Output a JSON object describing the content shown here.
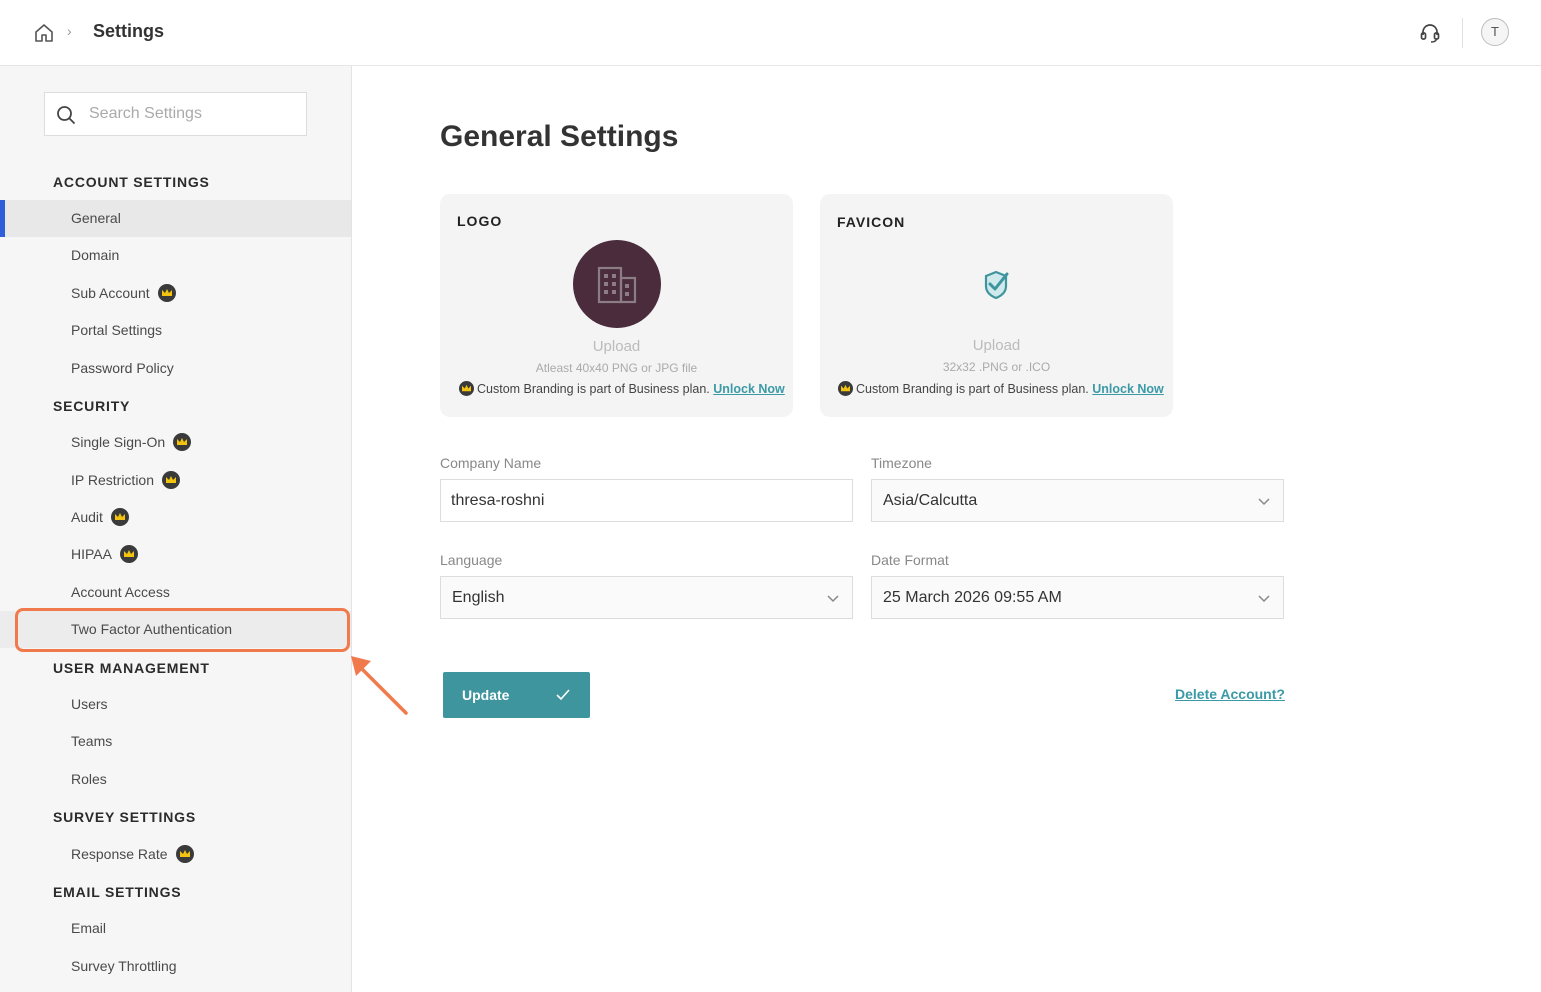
{
  "header": {
    "title": "Settings",
    "avatar_initial": "T"
  },
  "sidebar": {
    "search_placeholder": "Search Settings",
    "sections": {
      "account": "ACCOUNT SETTINGS",
      "security": "SECURITY",
      "user_management": "USER MANAGEMENT",
      "survey": "SURVEY SETTINGS",
      "email": "EMAIL SETTINGS"
    },
    "items": {
      "general": "General",
      "domain": "Domain",
      "sub_account": "Sub Account",
      "portal_settings": "Portal Settings",
      "password_policy": "Password Policy",
      "sso": "Single Sign-On",
      "ip_restriction": "IP Restriction",
      "audit": "Audit",
      "hipaa": "HIPAA",
      "account_access": "Account Access",
      "two_factor": "Two Factor Authentication",
      "users": "Users",
      "teams": "Teams",
      "roles": "Roles",
      "response_rate": "Response Rate",
      "email": "Email",
      "survey_throttling": "Survey Throttling"
    }
  },
  "main": {
    "title": "General Settings",
    "logo_card": {
      "title": "LOGO",
      "upload": "Upload",
      "hint": "Atleast 40x40 PNG or JPG file",
      "plan_note": "Custom Branding is part of Business plan.",
      "unlock": "Unlock Now"
    },
    "favicon_card": {
      "title": "FAVICON",
      "upload": "Upload",
      "hint": "32x32 .PNG or .ICO",
      "plan_note": "Custom Branding is part of Business plan.",
      "unlock": "Unlock Now"
    },
    "form": {
      "company_name_label": "Company Name",
      "company_name_value": "thresa-roshni",
      "timezone_label": "Timezone",
      "timezone_value": "Asia/Calcutta",
      "language_label": "Language",
      "language_value": "English",
      "date_format_label": "Date Format",
      "date_format_value": "25 March 2026 09:55 AM"
    },
    "update_label": "Update",
    "delete_label": "Delete Account?"
  },
  "colors": {
    "accent": "#3f959e",
    "active_bar": "#2f5fd8",
    "highlight": "#f07a4c",
    "crown_gold": "#f2c40f"
  },
  "icons": [
    "home-icon",
    "chevron-right-icon",
    "headset-icon",
    "search-icon",
    "crown-icon",
    "building-icon",
    "favicon-check-icon",
    "chevron-down-icon",
    "check-icon",
    "arrow-icon"
  ]
}
